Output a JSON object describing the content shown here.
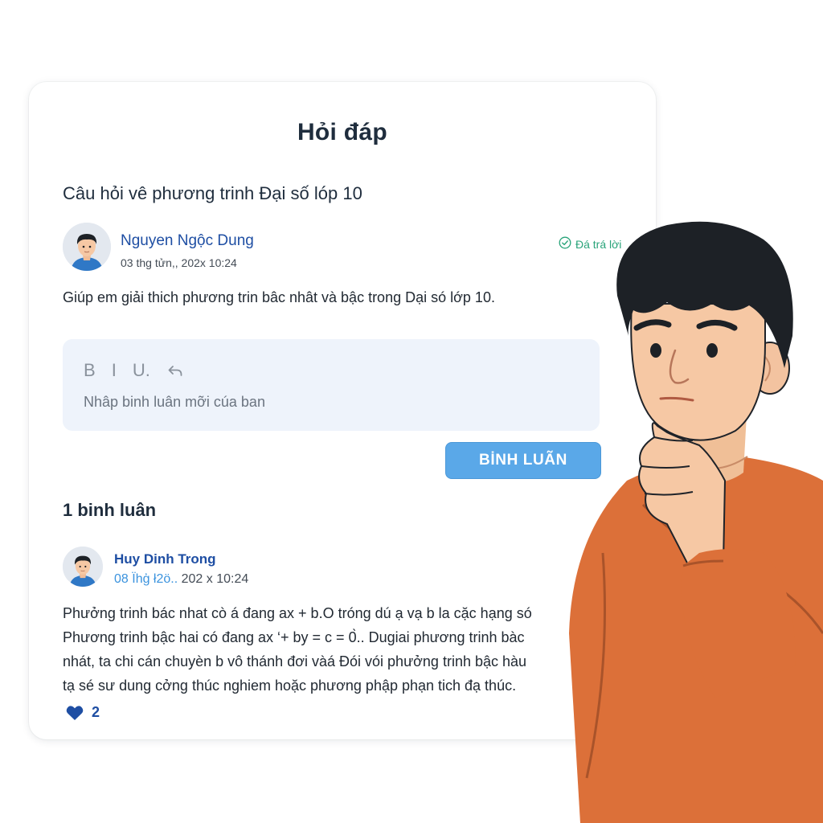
{
  "page": {
    "title": "Hỏi đáp"
  },
  "question": {
    "title": "Câu hỏi vê phương trinh Đại số lóp 10",
    "author": {
      "name": "Nguyen Ngộc Dung",
      "date": "03 thg tửn,, 202x 10:24",
      "avatar_icon": "user-avatar-icon"
    },
    "status": {
      "label": "Đá trá lời",
      "icon": "check-circle-icon",
      "color": "#2aa47a"
    },
    "body": "Giúp em giải thich phương trin bâc nhât và bậc trong Dại só lớp 10."
  },
  "editor": {
    "toolbar": {
      "bold": "B",
      "italic": "I",
      "underline": "U.",
      "undo_icon": "undo-icon"
    },
    "placeholder": "Nhâp binh luân mỡi cúa ban",
    "value": ""
  },
  "submit": {
    "label": "BİNH LUÃN",
    "color": "#5aa8e8"
  },
  "comments": {
    "count_label": "1 binh luân",
    "items": [
      {
        "author": "Huy Dinh Trong",
        "date_link": "08 Ïhģ ł2ö..",
        "date_rest": " 202 x 10:24",
        "lines": [
          "Phưởng trinh bác nhat cò á đang ax + b.O tróng dú ạ vạ b la cặc hạng só",
          "Phương trinh bậc hai có đang ax ‘+ by = c = 0̀.. Dugiai phương trinh bàc",
          "nhát, ta chi cán chuyèn b vô thánh đơi vàá Đói vói phưởng trinh bậc hàu",
          "tạ sé sư dung cởng thúc nghiem hoặc phương phập phạn tich đạ thúc."
        ],
        "likes": "2",
        "like_icon": "heart-icon"
      }
    ]
  },
  "colors": {
    "brand_blue": "#1e4ea3",
    "heading": "#1f2d3d"
  }
}
